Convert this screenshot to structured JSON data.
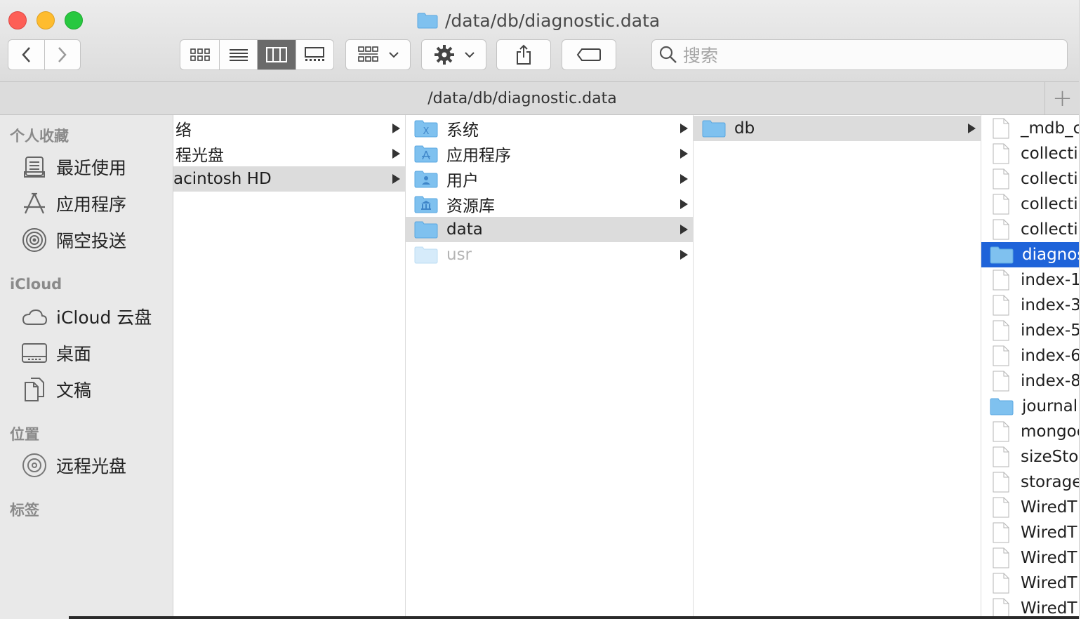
{
  "window": {
    "title": "/data/db/diagnostic.data",
    "path": "/data/db/diagnostic.data",
    "search_placeholder": "搜索",
    "add_tab": "+"
  },
  "sidebar": {
    "favorites_header": "个人收藏",
    "favorites": [
      {
        "label": "最近使用",
        "icon": "recents-icon"
      },
      {
        "label": "应用程序",
        "icon": "applications-icon"
      },
      {
        "label": "隔空投送",
        "icon": "airdrop-icon"
      }
    ],
    "icloud_header": "iCloud",
    "icloud": [
      {
        "label": "iCloud 云盘",
        "icon": "cloud-icon"
      },
      {
        "label": "桌面",
        "icon": "desktop-icon"
      },
      {
        "label": "文稿",
        "icon": "documents-icon"
      }
    ],
    "locations_header": "位置",
    "locations": [
      {
        "label": "远程光盘",
        "icon": "disc-icon"
      }
    ],
    "tags_header": "标签"
  },
  "columns": {
    "col1": [
      "络",
      "程光盘",
      "acintosh HD"
    ],
    "col2": [
      "系统",
      "应用程序",
      "用户",
      "资源库",
      "data",
      "usr"
    ],
    "col3": [
      "db"
    ],
    "col4": [
      "_mdb_c",
      "collecti",
      "collecti",
      "collecti",
      "collecti",
      "diagnos",
      "index-1",
      "index-3",
      "index-5",
      "index-6",
      "index-8",
      "journal",
      "mongoc",
      "sizeSto",
      "storage",
      "WiredT",
      "WiredT",
      "WiredT",
      "WiredT",
      "WiredT"
    ]
  }
}
